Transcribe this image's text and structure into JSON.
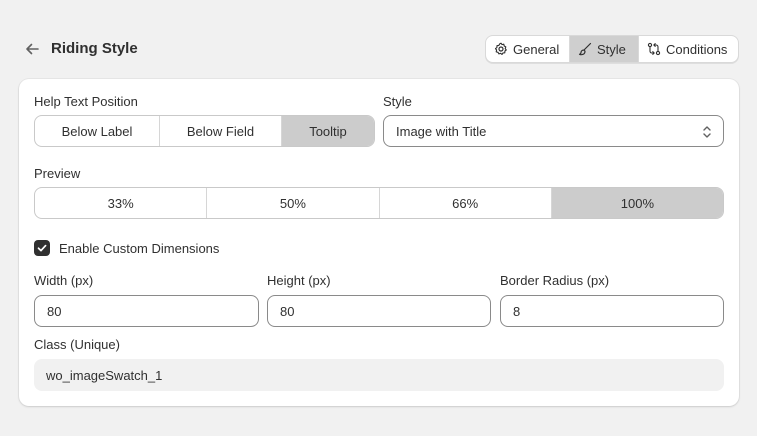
{
  "header": {
    "back_icon": "arrow-left-icon",
    "title": "Riding Style",
    "tabs": [
      {
        "label": "General",
        "icon": "gear-icon",
        "active": false
      },
      {
        "label": "Style",
        "icon": "brush-icon",
        "active": true
      },
      {
        "label": "Conditions",
        "icon": "conditions-icon",
        "active": false
      }
    ]
  },
  "form": {
    "help_text_position": {
      "label": "Help Text Position",
      "options": [
        "Below Label",
        "Below Field",
        "Tooltip"
      ],
      "selected": "Tooltip"
    },
    "style": {
      "label": "Style",
      "value": "Image with Title",
      "icon": "select-chevrons-icon"
    },
    "preview": {
      "label": "Preview",
      "options": [
        "33%",
        "50%",
        "66%",
        "100%"
      ],
      "selected": "100%"
    },
    "custom_dimensions": {
      "label": "Enable Custom Dimensions",
      "checked": true
    },
    "width": {
      "label": "Width (px)",
      "value": "80"
    },
    "height": {
      "label": "Height (px)",
      "value": "80"
    },
    "border_radius": {
      "label": "Border Radius (px)",
      "value": "8"
    },
    "class_unique": {
      "label": "Class (Unique)",
      "value": "wo_imageSwatch_1"
    }
  },
  "colors": {
    "background": "#f1f1f1",
    "card": "#ffffff",
    "active_segment": "#cccccc",
    "text": "#303030"
  }
}
